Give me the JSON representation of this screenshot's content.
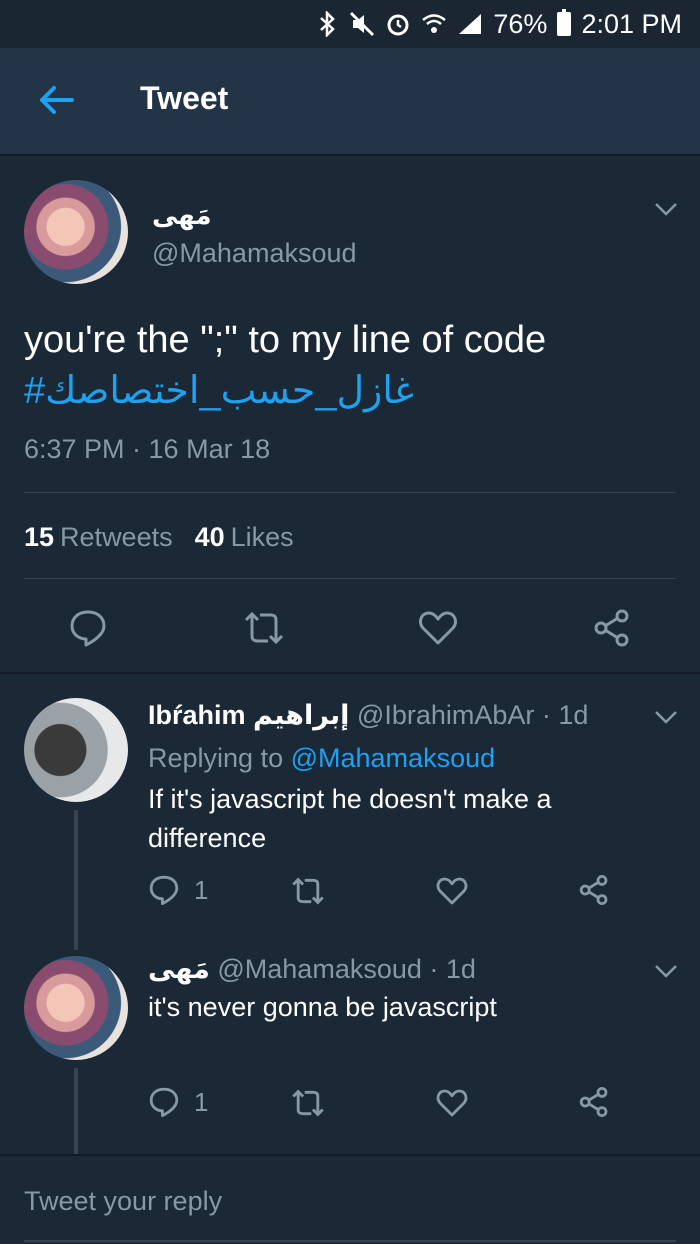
{
  "status_bar": {
    "battery_percent": "76%",
    "time": "2:01 PM"
  },
  "header": {
    "title": "Tweet"
  },
  "main_tweet": {
    "name": "مَهى",
    "handle": "@Mahamaksoud",
    "text": "you're the \";\" to my line of code",
    "hashtag": "#غازل_حسب_اختصاصك",
    "timestamp": "6:37 PM · 16 Mar 18",
    "retweets_count": "15",
    "retweets_label": "Retweets",
    "likes_count": "40",
    "likes_label": "Likes"
  },
  "replies": [
    {
      "name": "Ibŕahim إبراهيم",
      "handle_time": "@IbrahimAbAr · 1d",
      "replying_prefix": "Replying to",
      "replying_handle": "@Mahamaksoud",
      "text": "If it's javascript he doesn't make a difference",
      "reply_count": "1"
    },
    {
      "name": "مَهى",
      "handle_time": "@Mahamaksoud · 1d",
      "text": "it's never gonna be javascript",
      "reply_count": "1"
    }
  ],
  "composer": {
    "placeholder": "Tweet your reply"
  },
  "colors": {
    "background": "#1b2836",
    "header": "#243447",
    "accent": "#1da1f2",
    "secondary_text": "#8899a6"
  }
}
